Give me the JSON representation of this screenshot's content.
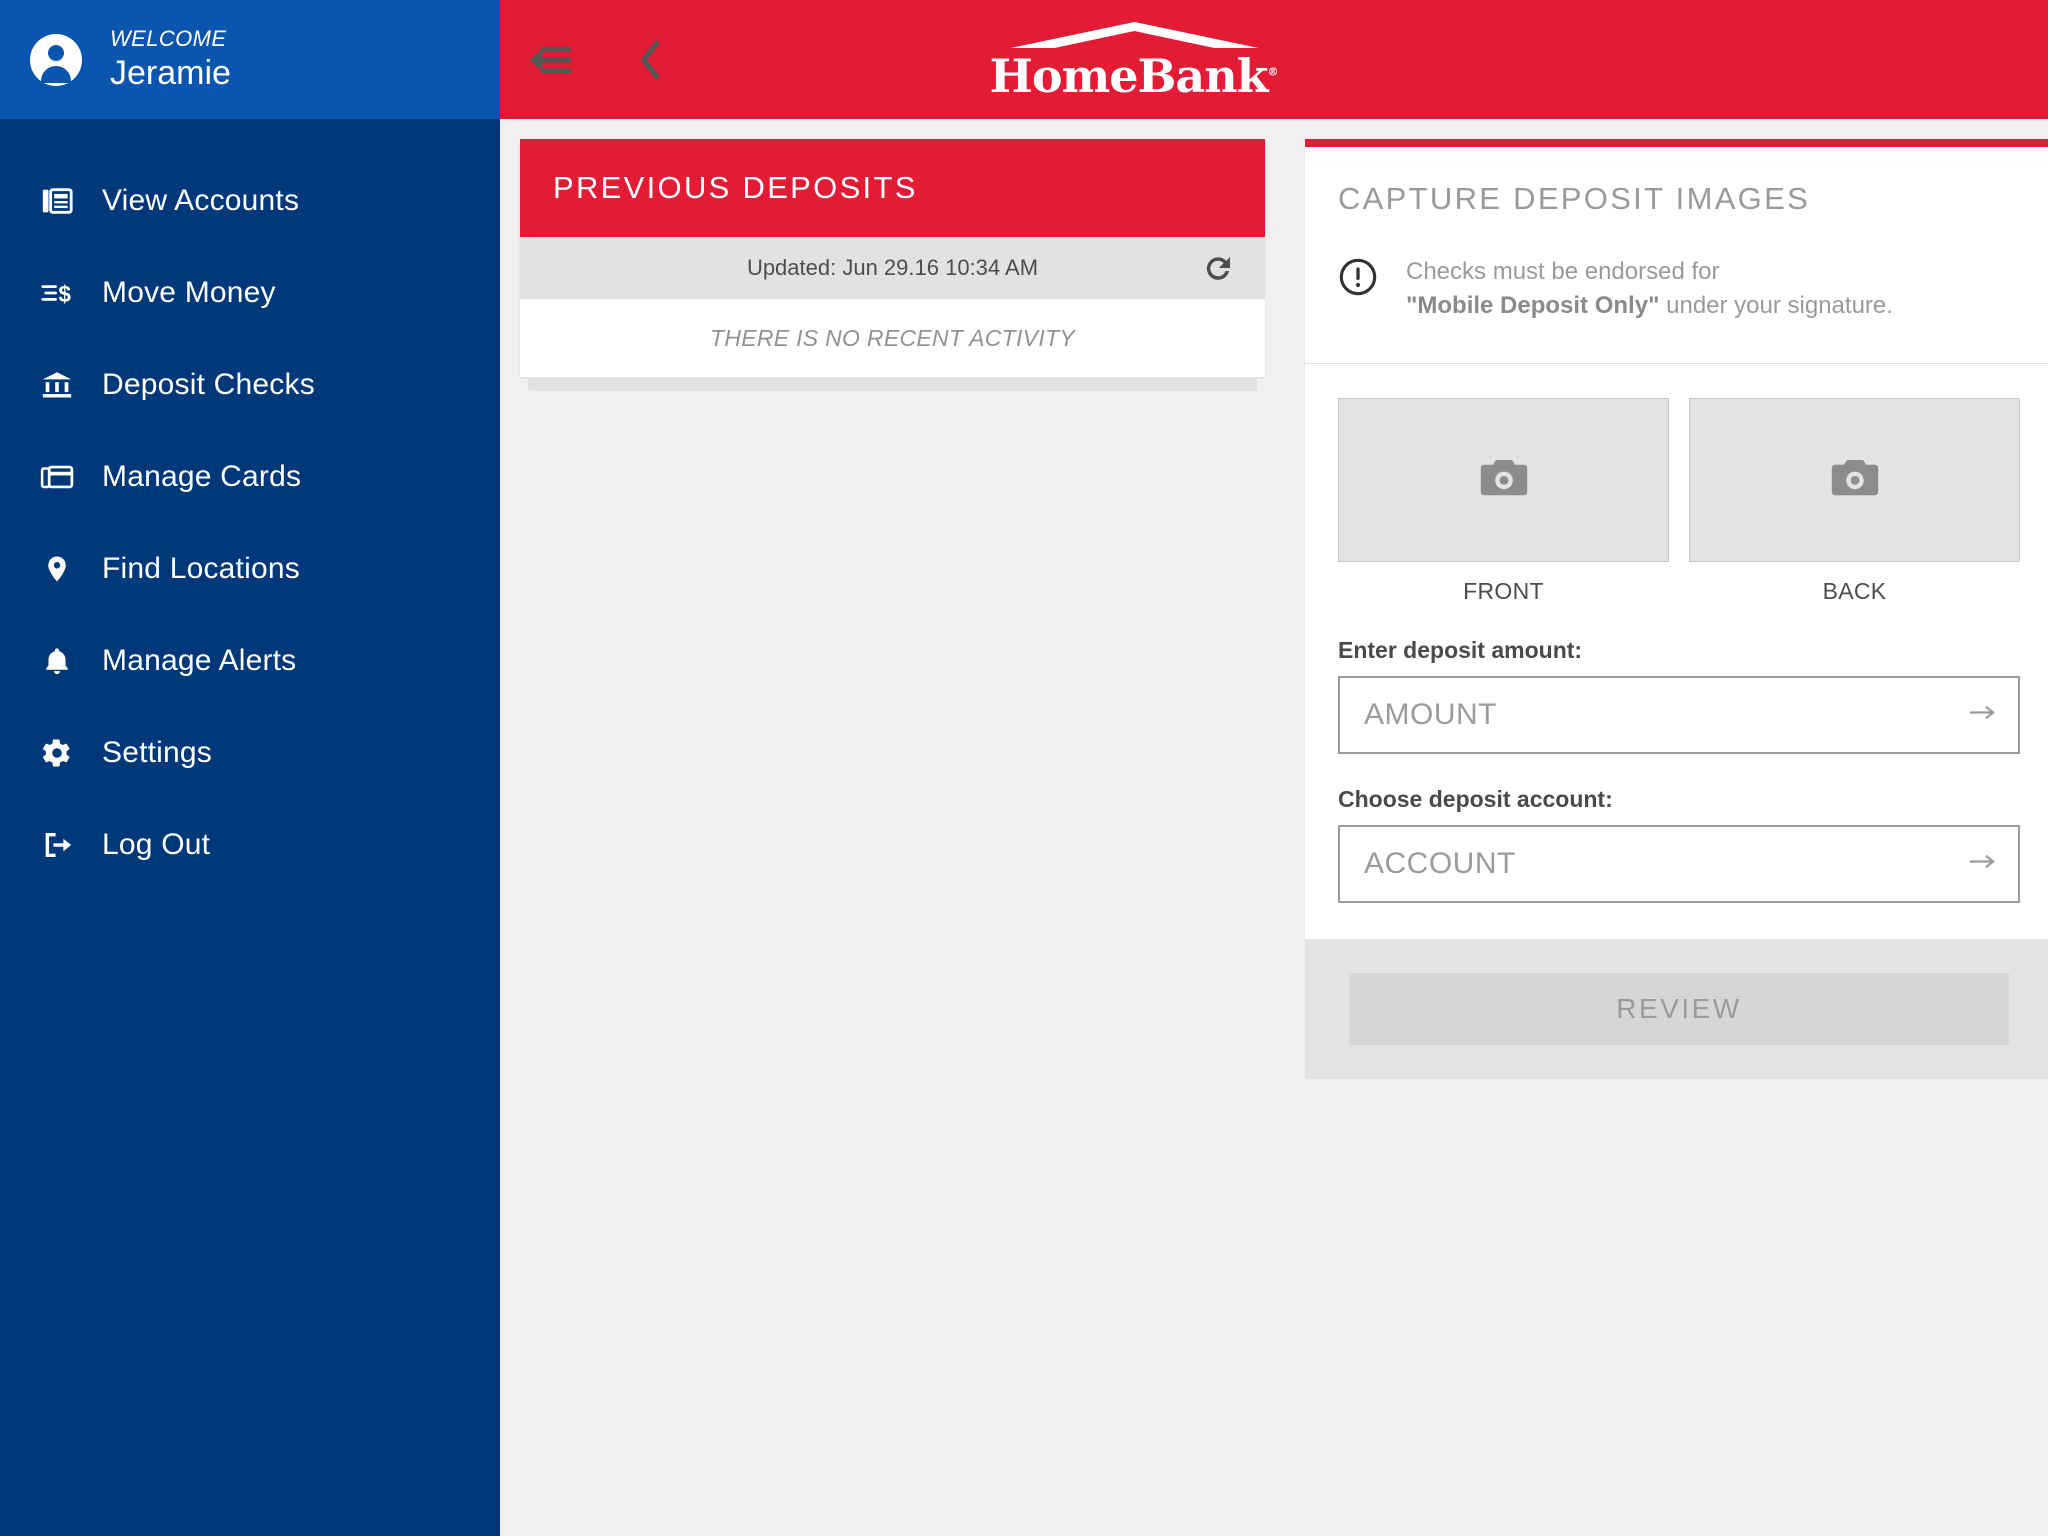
{
  "sidebar": {
    "welcome_label": "WELCOME",
    "user_name": "Jeramie",
    "avatar_icon": "user-avatar-icon",
    "items": [
      {
        "label": "View Accounts",
        "icon": "accounts-list-icon"
      },
      {
        "label": "Move Money",
        "icon": "transfer-dollar-icon"
      },
      {
        "label": "Deposit Checks",
        "icon": "bank-building-icon"
      },
      {
        "label": "Manage Cards",
        "icon": "credit-cards-icon"
      },
      {
        "label": "Find Locations",
        "icon": "map-pin-icon"
      },
      {
        "label": "Manage Alerts",
        "icon": "bell-icon"
      },
      {
        "label": "Settings",
        "icon": "gear-icon"
      },
      {
        "label": "Log Out",
        "icon": "logout-arrow-icon"
      }
    ]
  },
  "header": {
    "menu_icon": "collapse-menu-icon",
    "back_icon": "chevron-left-icon",
    "logo_text": "HomeBank",
    "logo_tm": "®",
    "brand_red": "#e41b34"
  },
  "previous_deposits": {
    "title": "PREVIOUS DEPOSITS",
    "updated_text": "Updated: Jun 29.16 10:34 AM",
    "refresh_icon": "refresh-icon",
    "empty_text": "THERE IS NO RECENT ACTIVITY"
  },
  "capture_deposit": {
    "title": "CAPTURE DEPOSIT IMAGES",
    "warning_icon": "exclamation-circle-icon",
    "warning_line1": "Checks must be endorsed for",
    "warning_bold": "\"Mobile Deposit Only\"",
    "warning_line2_rest": " under your signature.",
    "captures": [
      {
        "label": "FRONT",
        "icon": "camera-icon"
      },
      {
        "label": "BACK",
        "icon": "camera-icon"
      }
    ],
    "amount_label": "Enter deposit amount:",
    "amount_placeholder": "AMOUNT",
    "account_label": "Choose deposit account:",
    "account_placeholder": "ACCOUNT",
    "field_arrow_icon": "arrow-right-icon",
    "review_label": "REVIEW"
  },
  "colors": {
    "sidebar_dark": "#00387a",
    "sidebar_welcome": "#0a55ae",
    "accent_red": "#e41b34",
    "page_bg": "#f0f0f0"
  }
}
